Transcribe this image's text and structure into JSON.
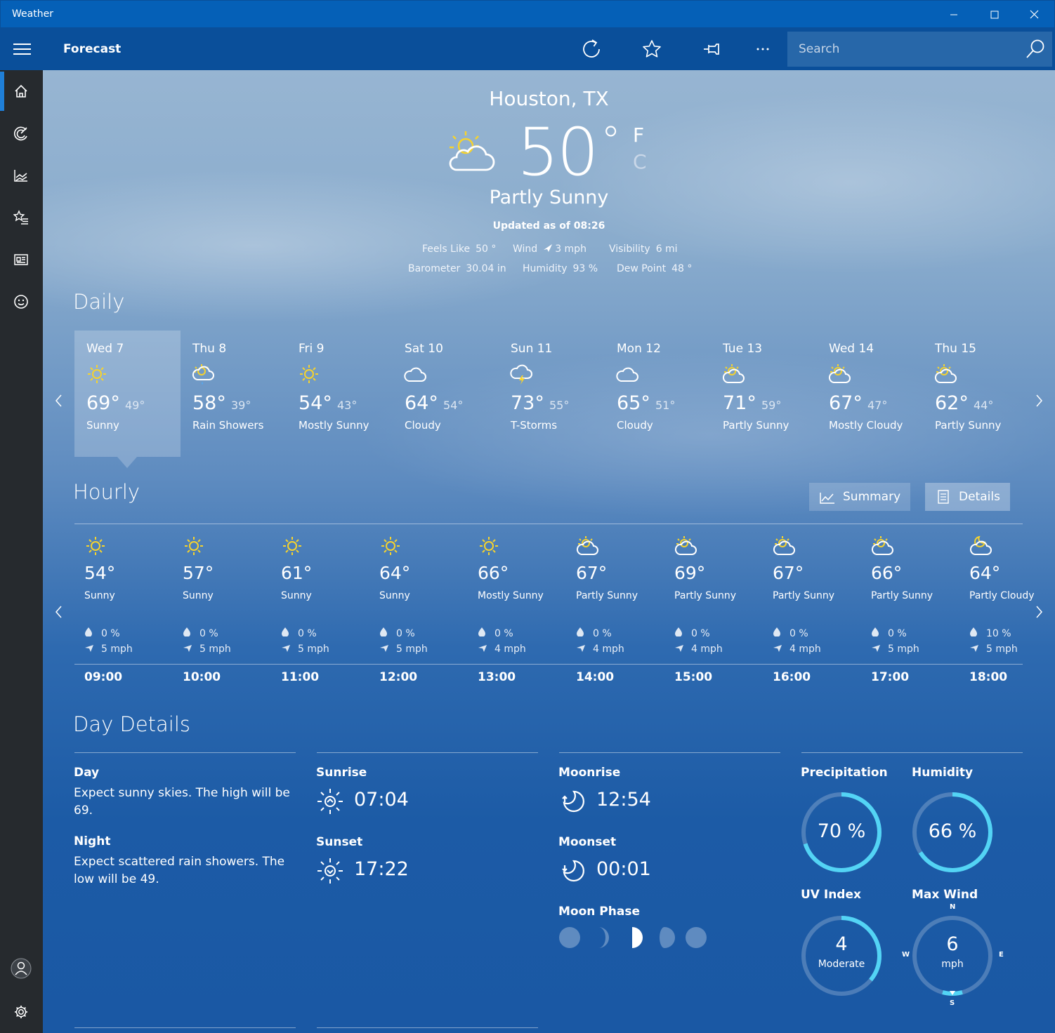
{
  "window": {
    "title": "Weather"
  },
  "appbar": {
    "title": "Forecast",
    "search_placeholder": "Search"
  },
  "current": {
    "location": "Houston, TX",
    "temp": "50",
    "deg": "°",
    "unit_f": "F",
    "unit_c": "C",
    "condition": "Partly Sunny",
    "updated": "Updated as of 08:26",
    "details": [
      {
        "label": "Feels Like",
        "value": "50 °"
      },
      {
        "label": "Wind",
        "value": "3 mph"
      },
      {
        "label": "Visibility",
        "value": "6 mi"
      },
      {
        "label": "Barometer",
        "value": "30.04 in"
      },
      {
        "label": "Humidity",
        "value": "93 %"
      },
      {
        "label": "Dew Point",
        "value": "48 °"
      }
    ]
  },
  "daily": {
    "title": "Daily",
    "days": [
      {
        "name": "Wed 7",
        "hi": "69°",
        "lo": "49°",
        "desc": "Sunny",
        "icon": "sun-icon"
      },
      {
        "name": "Thu 8",
        "hi": "58°",
        "lo": "39°",
        "desc": "Rain Showers",
        "icon": "rain-showers-icon"
      },
      {
        "name": "Fri 9",
        "hi": "54°",
        "lo": "43°",
        "desc": "Mostly Sunny",
        "icon": "sun-icon"
      },
      {
        "name": "Sat 10",
        "hi": "64°",
        "lo": "54°",
        "desc": "Cloudy",
        "icon": "cloud-icon"
      },
      {
        "name": "Sun 11",
        "hi": "73°",
        "lo": "55°",
        "desc": "T-Storms",
        "icon": "thunderstorm-icon"
      },
      {
        "name": "Mon 12",
        "hi": "65°",
        "lo": "51°",
        "desc": "Cloudy",
        "icon": "cloud-icon"
      },
      {
        "name": "Tue 13",
        "hi": "71°",
        "lo": "59°",
        "desc": "Partly Sunny",
        "icon": "partly-sunny-icon"
      },
      {
        "name": "Wed 14",
        "hi": "67°",
        "lo": "47°",
        "desc": "Mostly Cloudy",
        "icon": "partly-sunny-icon"
      },
      {
        "name": "Thu 15",
        "hi": "62°",
        "lo": "44°",
        "desc": "Partly Sunny",
        "icon": "partly-sunny-icon"
      }
    ]
  },
  "hourly": {
    "title": "Hourly",
    "summary_label": "Summary",
    "details_label": "Details",
    "hours": [
      {
        "temp": "54°",
        "desc": "Sunny",
        "precip": "0 %",
        "wind": "5 mph",
        "time": "09:00",
        "icon": "sun-icon"
      },
      {
        "temp": "57°",
        "desc": "Sunny",
        "precip": "0 %",
        "wind": "5 mph",
        "time": "10:00",
        "icon": "sun-icon"
      },
      {
        "temp": "61°",
        "desc": "Sunny",
        "precip": "0 %",
        "wind": "5 mph",
        "time": "11:00",
        "icon": "sun-icon"
      },
      {
        "temp": "64°",
        "desc": "Sunny",
        "precip": "0 %",
        "wind": "5 mph",
        "time": "12:00",
        "icon": "sun-icon"
      },
      {
        "temp": "66°",
        "desc": "Mostly Sunny",
        "precip": "0 %",
        "wind": "4 mph",
        "time": "13:00",
        "icon": "sun-icon"
      },
      {
        "temp": "67°",
        "desc": "Partly Sunny",
        "precip": "0 %",
        "wind": "4 mph",
        "time": "14:00",
        "icon": "partly-sunny-icon"
      },
      {
        "temp": "69°",
        "desc": "Partly Sunny",
        "precip": "0 %",
        "wind": "4 mph",
        "time": "15:00",
        "icon": "partly-sunny-icon"
      },
      {
        "temp": "67°",
        "desc": "Partly Sunny",
        "precip": "0 %",
        "wind": "4 mph",
        "time": "16:00",
        "icon": "partly-sunny-icon"
      },
      {
        "temp": "66°",
        "desc": "Partly Sunny",
        "precip": "0 %",
        "wind": "5 mph",
        "time": "17:00",
        "icon": "partly-sunny-icon"
      },
      {
        "temp": "64°",
        "desc": "Partly Cloudy",
        "precip": "10 %",
        "wind": "5 mph",
        "time": "18:00",
        "icon": "partly-cloudy-night-icon"
      }
    ]
  },
  "day_details": {
    "title": "Day Details",
    "day_label": "Day",
    "day_text": "Expect sunny skies. The high will be 69.",
    "night_label": "Night",
    "night_text": "Expect scattered rain showers. The low will be 49.",
    "sunrise_label": "Sunrise",
    "sunrise": "07:04",
    "sunset_label": "Sunset",
    "sunset": "17:22",
    "moonrise_label": "Moonrise",
    "moonrise": "12:54",
    "moonset_label": "Moonset",
    "moonset": "00:01",
    "moonphase_label": "Moon Phase",
    "precip_label": "Precipitation",
    "precip": "70 %",
    "precip_fraction": 0.7,
    "humidity_label": "Humidity",
    "humidity": "66 %",
    "humidity_fraction": 0.66,
    "uv_label": "UV Index",
    "uv": "4",
    "uv_desc": "Moderate",
    "uv_fraction": 0.36,
    "wind_label": "Max Wind",
    "wind": "6",
    "wind_unit": "mph",
    "compass": {
      "n": "N",
      "e": "E",
      "s": "S",
      "w": "W"
    }
  },
  "colors": {
    "gauge_accent": "#53d4f5",
    "sun": "#f6d32d",
    "nav_accent": "#1f7fd8"
  }
}
